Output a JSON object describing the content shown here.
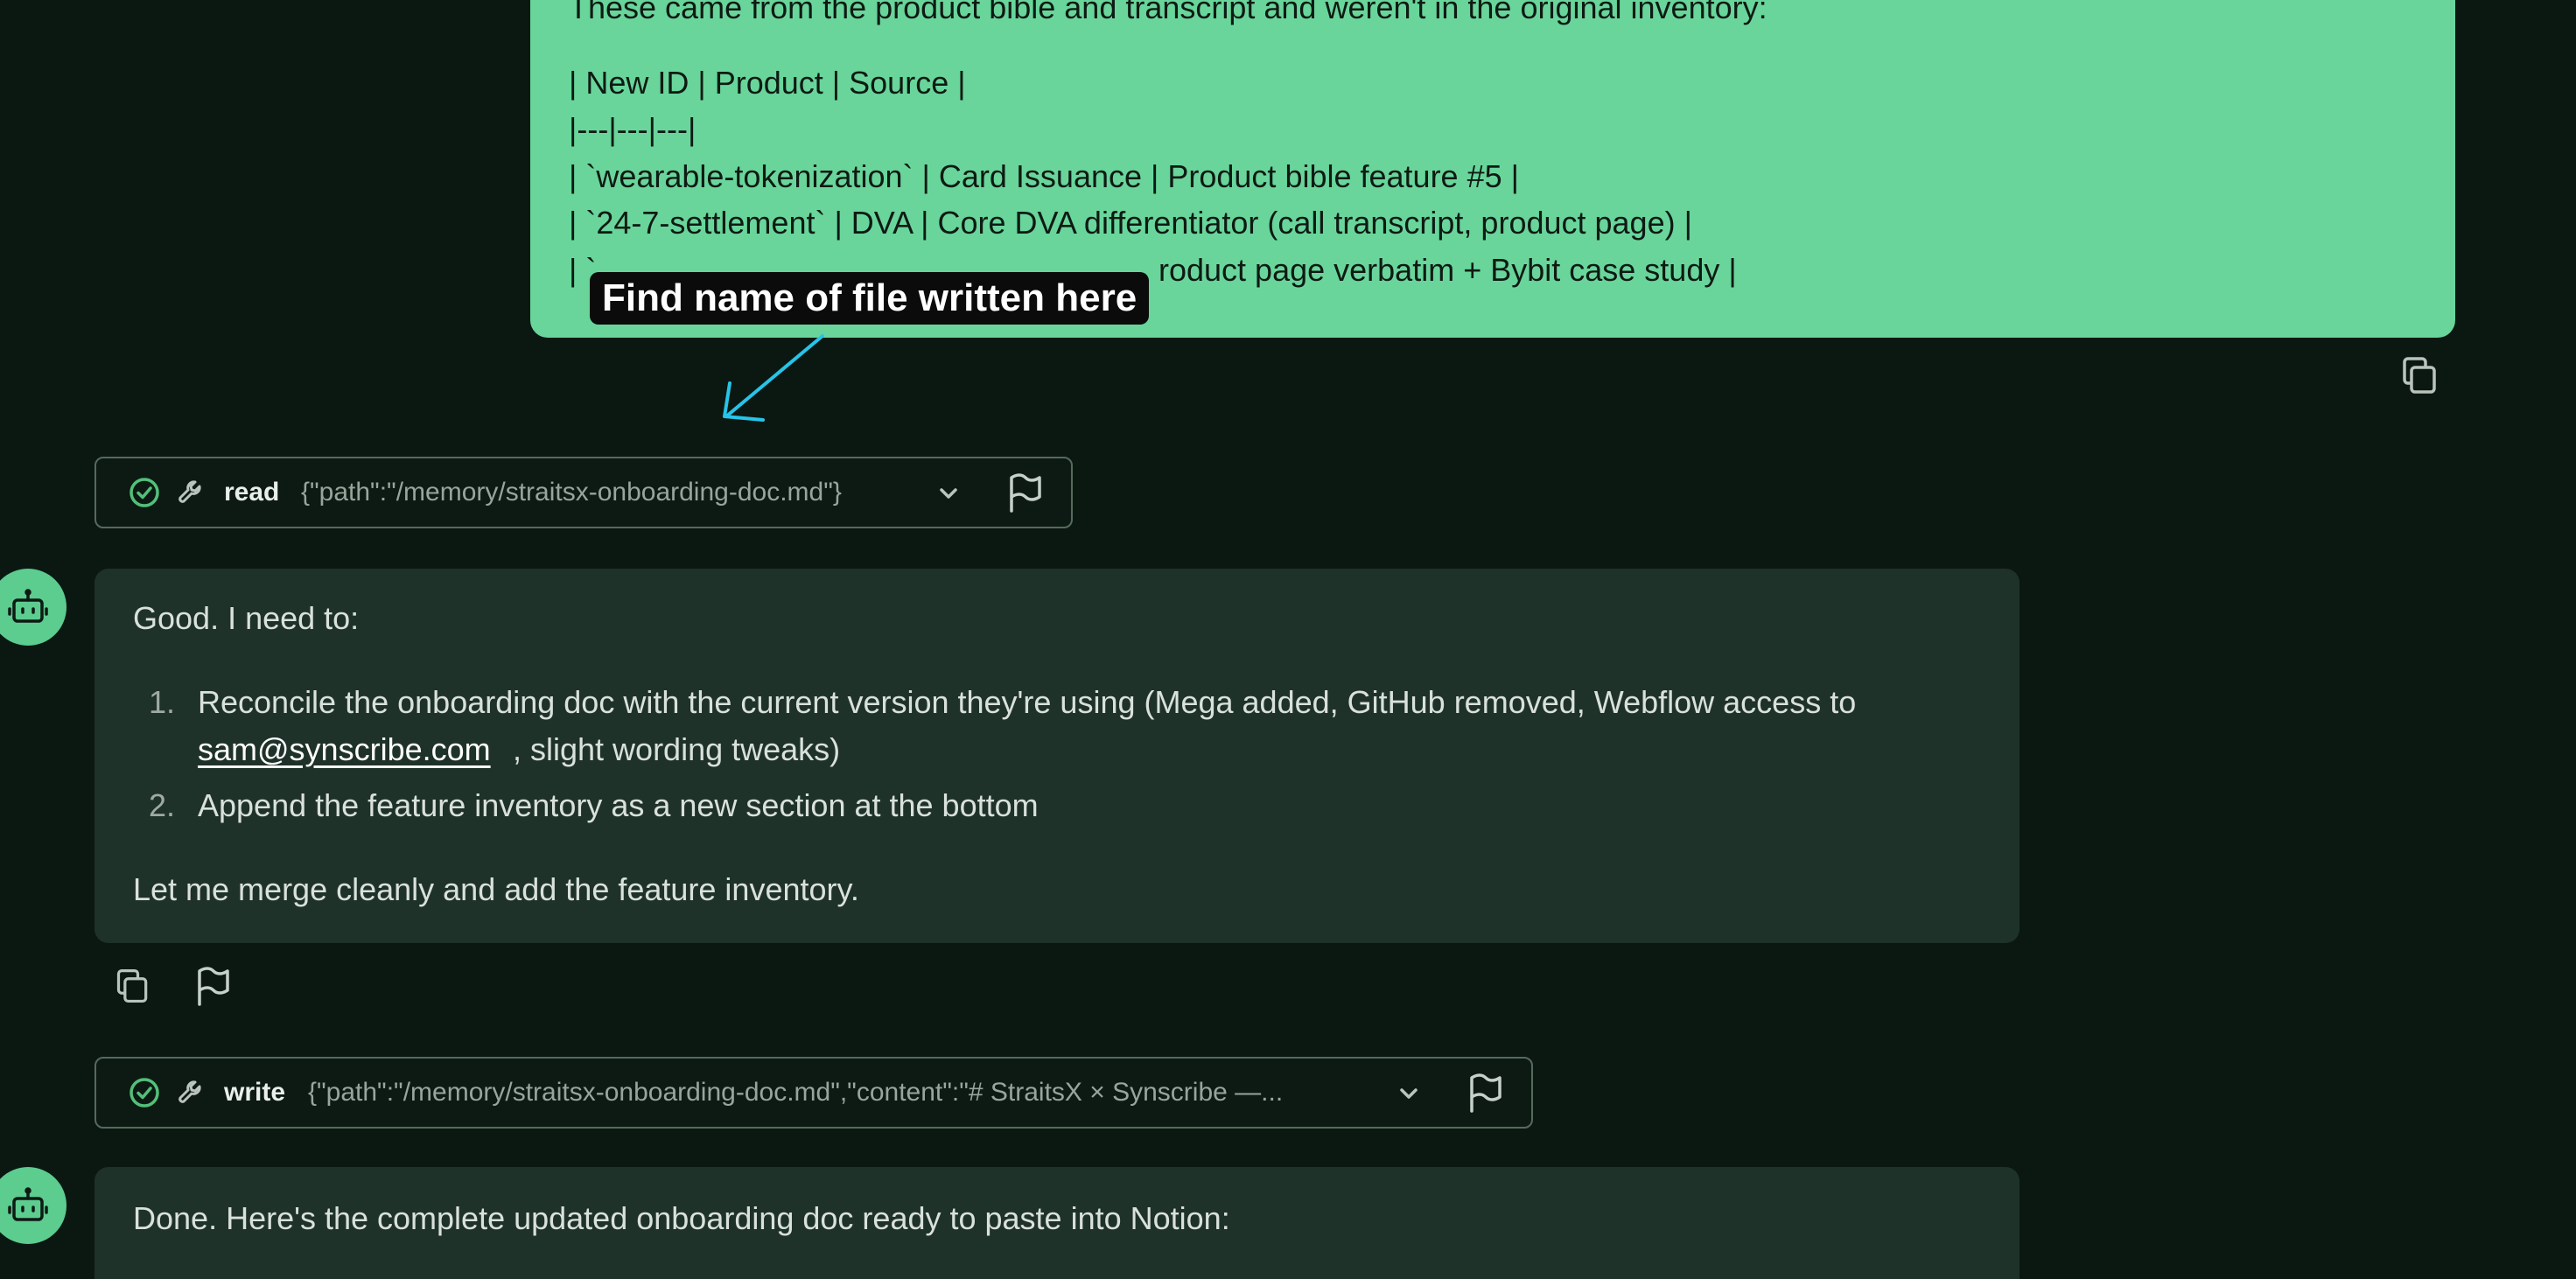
{
  "user_message": {
    "lines": [
      "These came from the product bible and transcript and weren't in the original inventory:",
      "| New ID | Product | Source |",
      "|---|---|---|",
      "| `wearable-tokenization` | Card Issuance | Product bible feature #5 |",
      "| `24-7-settlement` | DVA | Core DVA differentiator (call transcript, product page) |",
      "| `",
      "roduct page verbatim + Bybit case study |"
    ]
  },
  "annotation": {
    "label": "Find name of file written here"
  },
  "tool_calls": [
    {
      "name": "read",
      "args": "{\"path\":\"/memory/straitsx-onboarding-doc.md\"}"
    },
    {
      "name": "write",
      "args": "{\"path\":\"/memory/straitsx-onboarding-doc.md\",\"content\":\"# StraitsX × Synscribe —..."
    }
  ],
  "assistant_messages": [
    {
      "intro": "Good. I need to:",
      "steps": [
        {
          "num": "1.",
          "text_line1": "Reconcile the onboarding doc with the current version they're using (Mega added, GitHub removed, Webflow access to",
          "email": "sam@synscribe.com",
          "text_line2_rest": ", slight wording tweaks)"
        },
        {
          "num": "2.",
          "text_line1": "Append the feature inventory as a new section at the bottom"
        }
      ],
      "outro": "Let me merge cleanly and add the feature inventory."
    },
    {
      "text": "Done. Here's the complete updated onboarding doc ready to paste into Notion:"
    }
  ],
  "icons": {
    "status": "check-circle-icon",
    "tool": "wrench-icon",
    "expand": "chevron-down-icon",
    "flag": "flag-icon",
    "copy": "copy-icon",
    "avatar": "robot-icon"
  },
  "colors": {
    "background": "#0b1812",
    "user_bubble": "#69d59b",
    "assistant_bubble": "#1f3229",
    "annotation_arrow": "#27c4e8",
    "annotation_underline": "#e8502f",
    "success": "#53c07a"
  }
}
